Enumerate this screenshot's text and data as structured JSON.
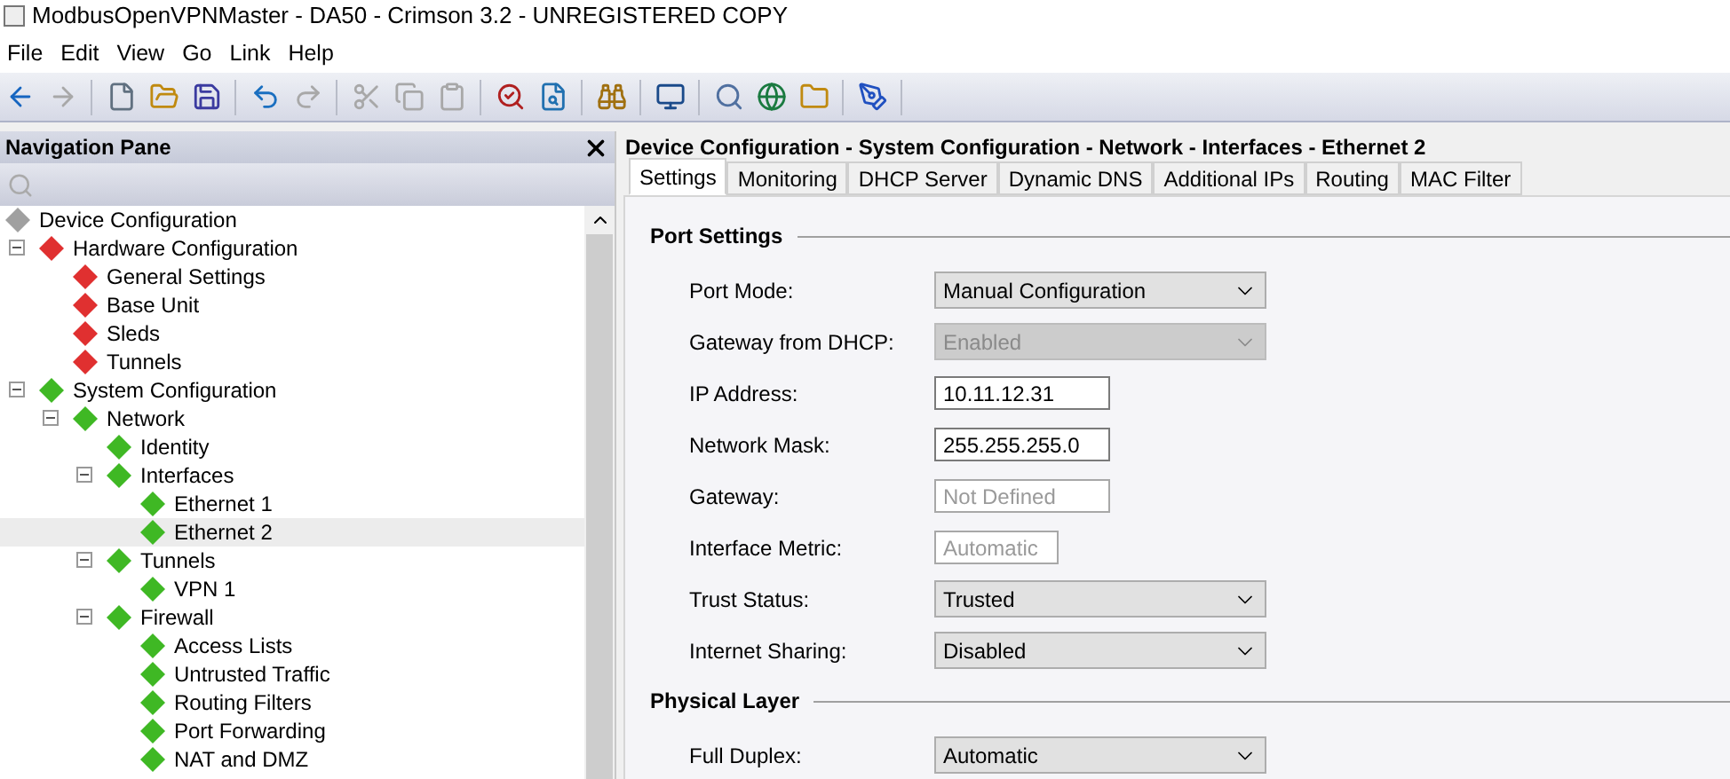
{
  "window": {
    "title": "ModbusOpenVPNMaster - DA50 - Crimson 3.2 - UNREGISTERED COPY"
  },
  "menu": [
    "File",
    "Edit",
    "View",
    "Go",
    "Link",
    "Help"
  ],
  "toolbar": [
    {
      "kind": "back",
      "disabled": false
    },
    {
      "kind": "forward",
      "disabled": true
    },
    {
      "kind": "sep"
    },
    {
      "kind": "new",
      "disabled": false
    },
    {
      "kind": "open",
      "disabled": false
    },
    {
      "kind": "save",
      "disabled": false
    },
    {
      "kind": "sep"
    },
    {
      "kind": "undo",
      "disabled": false
    },
    {
      "kind": "redo",
      "disabled": true
    },
    {
      "kind": "sep"
    },
    {
      "kind": "cut",
      "disabled": true
    },
    {
      "kind": "copy",
      "disabled": true
    },
    {
      "kind": "paste",
      "disabled": true
    },
    {
      "kind": "sep"
    },
    {
      "kind": "find-all",
      "disabled": false
    },
    {
      "kind": "find",
      "disabled": false
    },
    {
      "kind": "sep"
    },
    {
      "kind": "binoculars",
      "disabled": false
    },
    {
      "kind": "sep"
    },
    {
      "kind": "monitor",
      "disabled": false
    },
    {
      "kind": "sep"
    },
    {
      "kind": "search-doc",
      "disabled": false
    },
    {
      "kind": "globe",
      "disabled": false
    },
    {
      "kind": "folder",
      "disabled": false
    },
    {
      "kind": "sep"
    },
    {
      "kind": "pen",
      "disabled": false
    },
    {
      "kind": "sep"
    }
  ],
  "navigation_pane": {
    "title": "Navigation Pane",
    "tree": [
      {
        "label": "Device Configuration",
        "color": "#a0a0a0",
        "selected": false,
        "children": [
          {
            "label": "Hardware Configuration",
            "color": "#e03030",
            "selected": false,
            "expanded": true,
            "children": [
              {
                "label": "General Settings",
                "color": "#e03030",
                "selected": false
              },
              {
                "label": "Base Unit",
                "color": "#e03030",
                "selected": false
              },
              {
                "label": "Sleds",
                "color": "#e03030",
                "selected": false
              },
              {
                "label": "Tunnels",
                "color": "#e03030",
                "selected": false
              }
            ]
          },
          {
            "label": "System Configuration",
            "color": "#3fb824",
            "selected": false,
            "expanded": true,
            "children": [
              {
                "label": "Network",
                "color": "#3fb824",
                "selected": false,
                "expanded": true,
                "children": [
                  {
                    "label": "Identity",
                    "color": "#3fb824",
                    "selected": false
                  },
                  {
                    "label": "Interfaces",
                    "color": "#3fb824",
                    "selected": false,
                    "expanded": true,
                    "children": [
                      {
                        "label": "Ethernet 1",
                        "color": "#3fb824",
                        "selected": false
                      },
                      {
                        "label": "Ethernet 2",
                        "color": "#3fb824",
                        "selected": true
                      }
                    ]
                  },
                  {
                    "label": "Tunnels",
                    "color": "#3fb824",
                    "selected": false,
                    "expanded": true,
                    "children": [
                      {
                        "label": "VPN 1",
                        "color": "#3fb824",
                        "selected": false
                      }
                    ]
                  },
                  {
                    "label": "Firewall",
                    "color": "#3fb824",
                    "selected": false,
                    "expanded": true,
                    "children": [
                      {
                        "label": "Access Lists",
                        "color": "#3fb824",
                        "selected": false
                      },
                      {
                        "label": "Untrusted Traffic",
                        "color": "#3fb824",
                        "selected": false
                      },
                      {
                        "label": "Routing Filters",
                        "color": "#3fb824",
                        "selected": false
                      },
                      {
                        "label": "Port Forwarding",
                        "color": "#3fb824",
                        "selected": false
                      },
                      {
                        "label": "NAT and DMZ",
                        "color": "#3fb824",
                        "selected": false
                      }
                    ]
                  }
                ]
              }
            ]
          }
        ]
      }
    ]
  },
  "editor": {
    "breadcrumb": "Device Configuration - System Configuration - Network - Interfaces - Ethernet 2",
    "tabs": [
      {
        "label": "Settings",
        "selected": true
      },
      {
        "label": "Monitoring",
        "selected": false
      },
      {
        "label": "DHCP Server",
        "selected": false
      },
      {
        "label": "Dynamic DNS",
        "selected": false
      },
      {
        "label": "Additional IPs",
        "selected": false
      },
      {
        "label": "Routing",
        "selected": false
      },
      {
        "label": "MAC Filter",
        "selected": false
      }
    ],
    "sections": [
      {
        "title": "Port Settings",
        "fields": [
          {
            "label": "Port Mode:",
            "kind": "select",
            "value": "Manual Configuration",
            "disabled": false
          },
          {
            "label": "Gateway from DHCP:",
            "kind": "select",
            "value": "Enabled",
            "disabled": true
          },
          {
            "label": "IP Address:",
            "kind": "text",
            "value": "10.11.12.31",
            "disabled": false
          },
          {
            "label": "Network Mask:",
            "kind": "text",
            "value": "255.255.255.0",
            "disabled": false
          },
          {
            "label": "Gateway:",
            "kind": "text",
            "placeholder": "Not Defined",
            "disabled": true
          },
          {
            "label": "Interface Metric:",
            "kind": "short-text",
            "placeholder": "Automatic",
            "disabled": true
          },
          {
            "label": "Trust Status:",
            "kind": "select",
            "value": "Trusted",
            "disabled": false
          },
          {
            "label": "Internet Sharing:",
            "kind": "select",
            "value": "Disabled",
            "disabled": false
          }
        ]
      },
      {
        "title": "Physical Layer",
        "fields": [
          {
            "label": "Full Duplex:",
            "kind": "select",
            "value": "Automatic",
            "disabled": false
          }
        ]
      }
    ]
  }
}
